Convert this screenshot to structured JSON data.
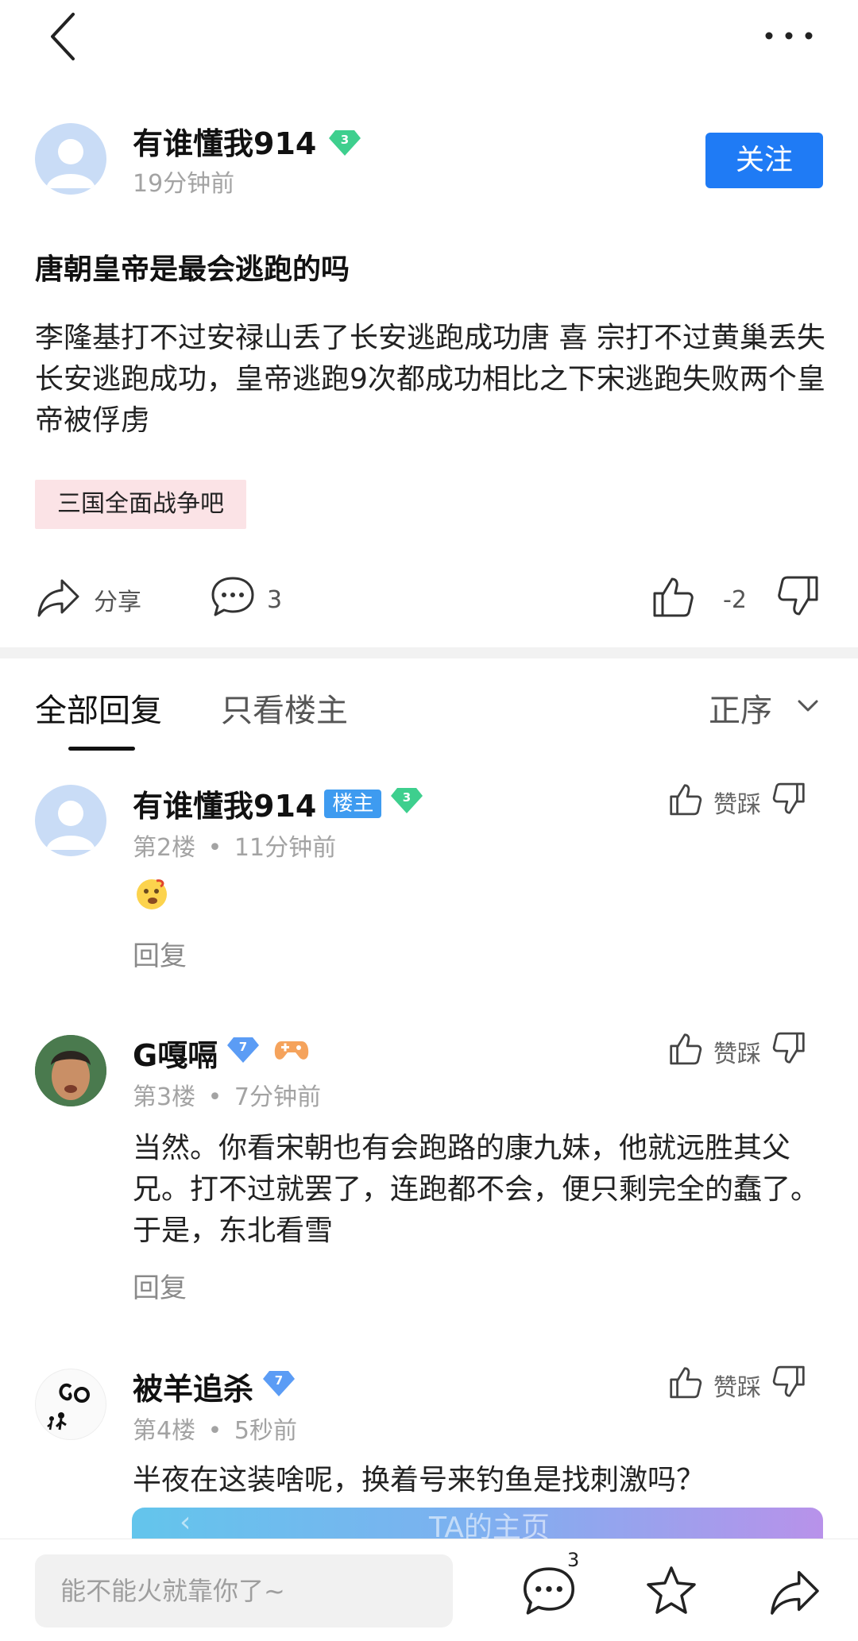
{
  "top_bar": {
    "back_icon": "chevron-left-icon",
    "more_icon": "more-horizontal-icon"
  },
  "post": {
    "author": {
      "name": "有谁懂我914",
      "level": "3",
      "time": "19分钟前"
    },
    "follow_label": "关注",
    "title": "唐朝皇帝是最会逃跑的吗",
    "body": "李隆基打不过安禄山丢了长安逃跑成功唐 喜 宗打不过黄巢丢失长安逃跑成功，皇帝逃跑9次都成功相比之下宋逃跑失败两个皇帝被俘虏",
    "tag": "三国全面战争吧",
    "actions": {
      "share_label": "分享",
      "comment_count": "3",
      "vote_score": "-2"
    }
  },
  "tabs": {
    "all_label": "全部回复",
    "op_only_label": "只看楼主",
    "sort_label": "正序"
  },
  "replies": [
    {
      "name": "有谁懂我914",
      "op_tag": "楼主",
      "level": "3",
      "floor": "第2楼",
      "time": "11分钟前",
      "text": "",
      "emoji": "thinking-face-emoji",
      "reply_label": "回复",
      "vote_label": "赞踩"
    },
    {
      "name": "G嘎嗝",
      "level": "7",
      "medal": "game-controller-icon",
      "floor": "第3楼",
      "time": "7分钟前",
      "text": "当然。你看宋朝也有会跑路的康九妹，他就远胜其父兄。打不过就罢了，连跑都不会，便只剩完全的蠢了。于是，东北看雪",
      "reply_label": "回复",
      "vote_label": "赞踩"
    },
    {
      "name": "被羊追杀",
      "level": "7",
      "floor": "第4楼",
      "time": "5秒前",
      "text": "半夜在这装啥呢，换着号来钓鱼是找刺激吗？",
      "vote_label": "赞踩"
    }
  ],
  "preview_card": {
    "title": "TA的主页"
  },
  "separator": "•",
  "bottom_bar": {
    "input_placeholder": "能不能火就靠你了~",
    "comment_badge": "3"
  },
  "colors": {
    "accent_blue": "#1f7bf5",
    "level_green": "#3ecf8e",
    "level_blue": "#5b9cf5",
    "tag_pink": "#fbe3e6"
  }
}
